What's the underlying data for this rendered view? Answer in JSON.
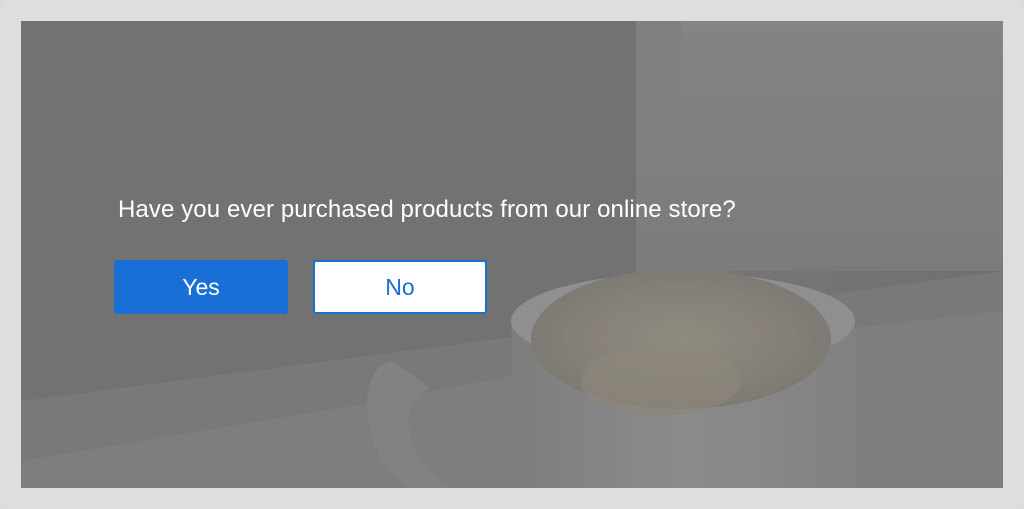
{
  "survey": {
    "question": "Have you ever purchased products from our online store?",
    "yes_label": "Yes",
    "no_label": "No"
  },
  "colors": {
    "accent": "#1a6fd6",
    "text_on_overlay": "#ffffff",
    "frame": "#dedede"
  },
  "background": {
    "image_subject": "coffee-mug-photo"
  }
}
